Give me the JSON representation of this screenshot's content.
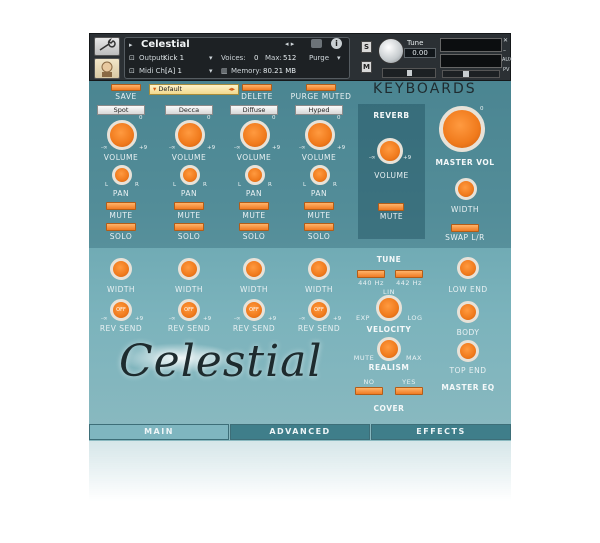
{
  "header": {
    "instrument_name": "Celestial",
    "output_label": "Output:",
    "output_value": "Kick 1",
    "voices_label": "Voices:",
    "voices_value": "0",
    "max_label": "Max:",
    "max_value": "512",
    "purge_label": "Purge",
    "midi_label": "Midi Ch:",
    "midi_value": "[A] 1",
    "memory_label": "Memory:",
    "memory_value": "80.21 MB",
    "s_label": "S",
    "m_label": "M",
    "tune_label": "Tune",
    "tune_value": "0.00",
    "aux_label": "AUX",
    "pv_label": "PV"
  },
  "preset_bar": {
    "save_label": "SAVE",
    "preset_value": "Default",
    "delete_label": "DELETE",
    "purge_muted_label": "PURGE MUTED",
    "logo": "KEYBOARDS"
  },
  "channels": [
    {
      "name": "Spot"
    },
    {
      "name": "Decca"
    },
    {
      "name": "Diffuse"
    },
    {
      "name": "Hyped"
    }
  ],
  "labels": {
    "volume": "VOLUME",
    "pan": "PAN",
    "mute": "MUTE",
    "solo": "SOLO",
    "width": "WIDTH",
    "rev_send": "REV SEND",
    "off": "OFF",
    "reverb": "REVERB",
    "master_vol": "MASTER VOL",
    "swap_lr": "SWAP L/R",
    "tune": "TUNE",
    "hz440": "440 Hz",
    "hz442": "442 Hz",
    "lin": "LIN",
    "exp": "EXP",
    "log": "LOG",
    "velocity": "VELOCITY",
    "mute_short": "MUTE",
    "max": "MAX",
    "realism": "REALISM",
    "no": "NO",
    "yes": "YES",
    "cover": "COVER",
    "low_end": "LOW END",
    "body": "BODY",
    "top_end": "TOP END",
    "master_eq": "MASTER EQ",
    "minus_inf": "-∞",
    "zero": "0",
    "plus9": "+9",
    "l": "L",
    "r": "R"
  },
  "title_art": "Celestial",
  "tabs": [
    {
      "label": "MAIN"
    },
    {
      "label": "ADVANCED"
    },
    {
      "label": "EFFECTS"
    }
  ],
  "colors": {
    "accent": "#f07a1c",
    "panel": "#6aa6b0",
    "header": "#2b3034"
  }
}
